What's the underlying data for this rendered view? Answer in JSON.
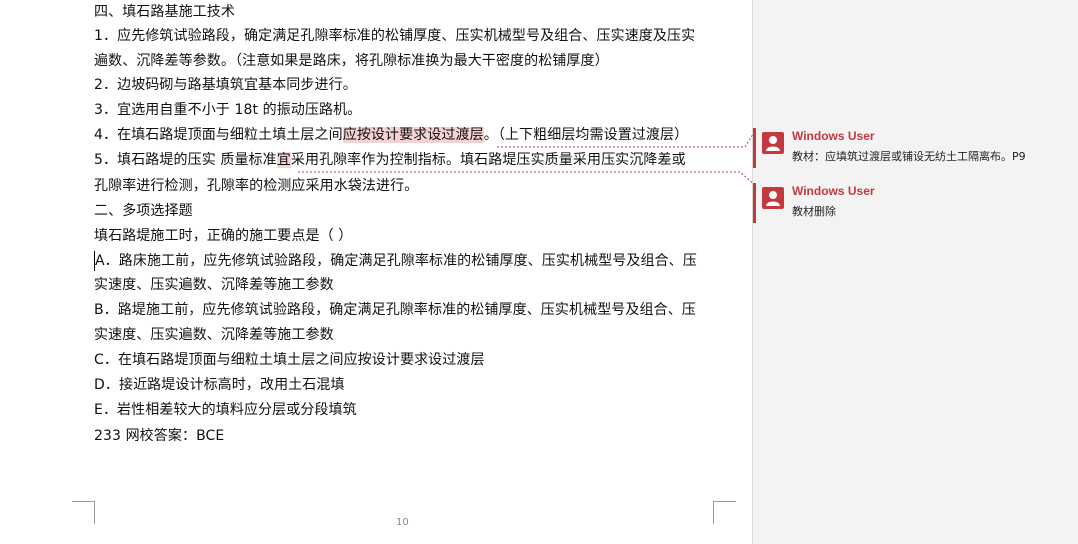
{
  "document": {
    "lines": [
      "四、填石路基施工技术",
      "1．应先修筑试验路段，确定满足孔隙率标准的松铺厚度、压实机械型号及组合、压实速度及压实",
      "遍数、沉降差等参数。（注意如果是路床，将孔隙标准换为最大干密度的松铺厚度）",
      "2．边坡码砌与路基填筑宜基本同步进行。",
      "3．宜选用自重不小于 18t 的振动压路机。"
    ],
    "line4": {
      "before": "4．在填石路堤顶面与细粒土填土层之间",
      "highlight": "应按设计要求设过渡层",
      "after": "。（上下粗细层均需设置过渡层）"
    },
    "line5": {
      "before": "5．填石路堤的压实  质量标准",
      "highlight": "宜",
      "after": "采用孔隙率作为控制指标。填石路堤压实质量采用压实沉降差或"
    },
    "lines_after": [
      "孔隙率进行检测，孔隙率的检测应采用水袋法进行。",
      "二、多项选择题",
      "填石路堤施工时，正确的施工要点是（      ）",
      "A．路床施工前，应先修筑试验路段，确定满足孔隙率标准的松铺厚度、压实机械型号及组合、压",
      "实速度、压实遍数、沉降差等施工参数",
      "B．路堤施工前，应先修筑试验路段，确定满足孔隙率标准的松铺厚度、压实机械型号及组合、压",
      "实速度、压实遍数、沉降差等施工参数",
      "C．在填石路堤顶面与细粒土填土层之间应按设计要求设过渡层",
      "D．接近路堤设计标高时，改用土石混填",
      "E．岩性相差较大的填料应分层或分段填筑",
      "233 网校答案：BCE"
    ],
    "page_number": "10"
  },
  "comments": [
    {
      "author": "Windows User",
      "text": "教材：应填筑过渡层或铺设无纺土工隔离布。P9"
    },
    {
      "author": "Windows User",
      "text": "教材删除"
    }
  ],
  "colors": {
    "comment_accent": "#c4393e",
    "highlight": "#f6d3d3",
    "pane_bg": "#f3f3f3"
  },
  "icons": {
    "comment_avatar": "user-avatar-icon"
  }
}
